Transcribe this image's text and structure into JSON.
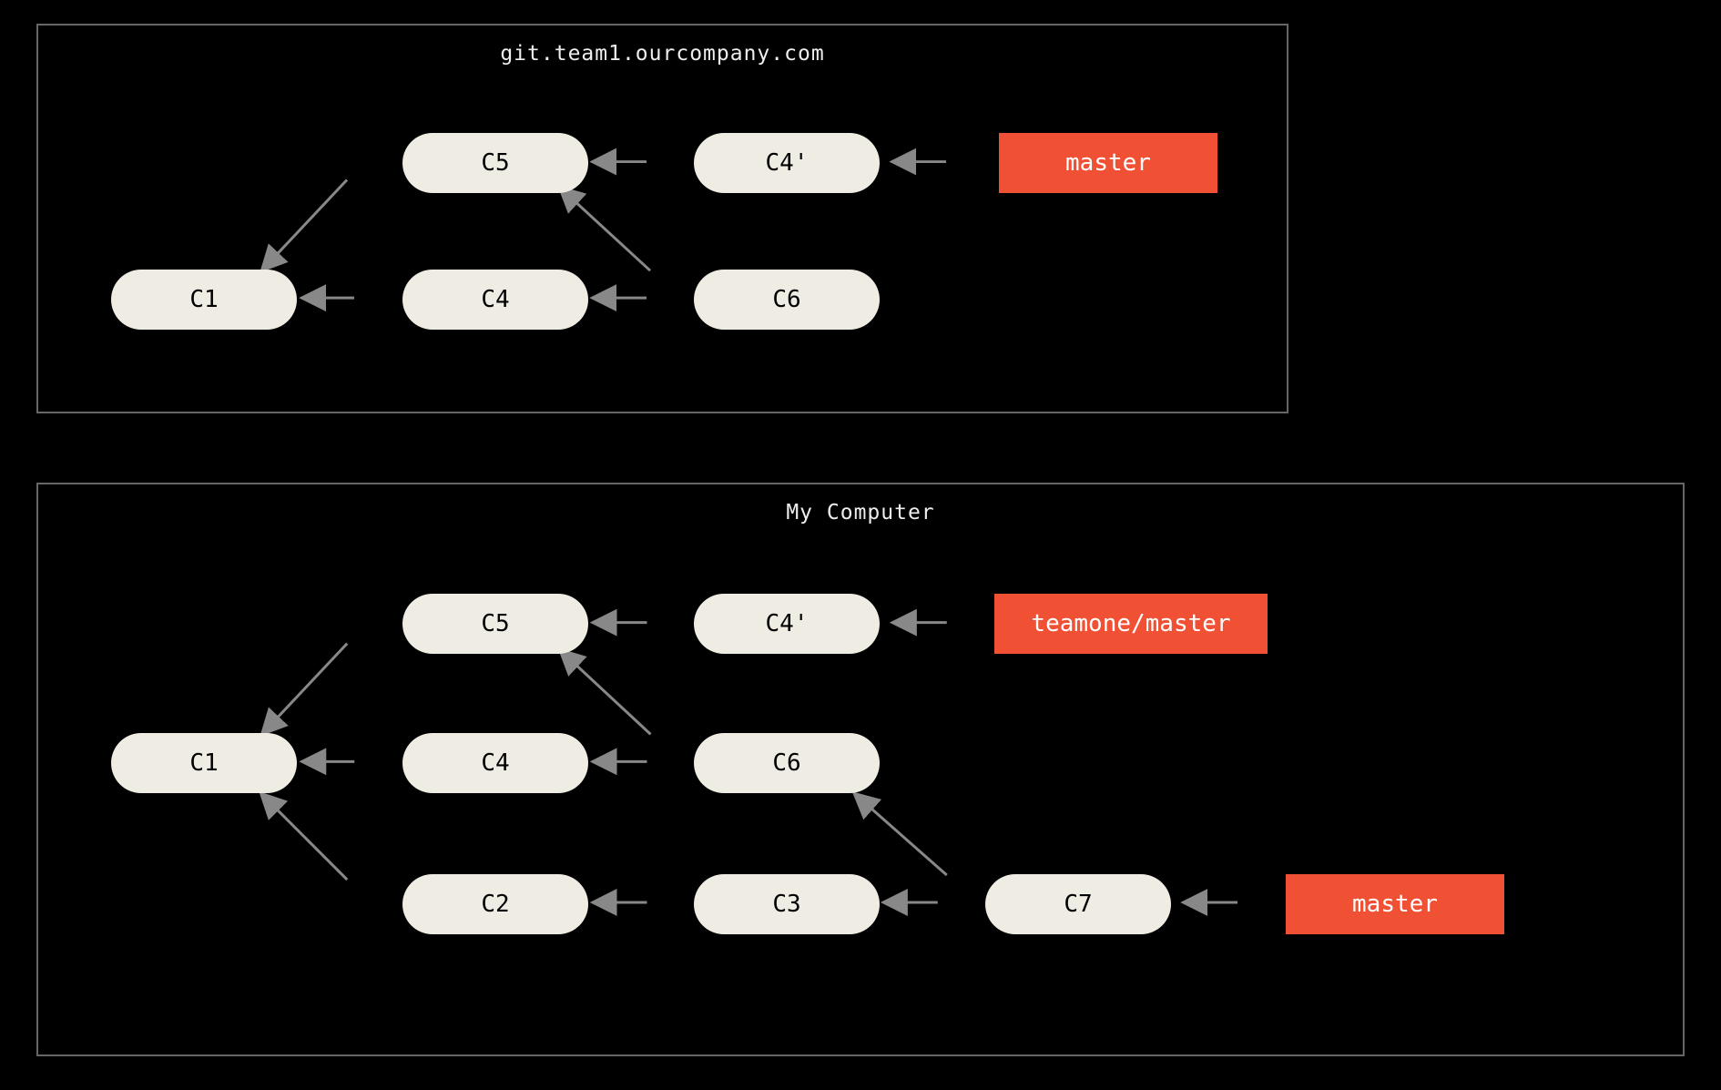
{
  "colors": {
    "background": "#000000",
    "panel_border": "#666666",
    "commit_fill": "#efece3",
    "ref_fill": "#f05033",
    "arrow": "#888888",
    "text_light": "#eeeeee"
  },
  "panels": {
    "remote": {
      "title": "git.team1.ourcompany.com",
      "commits": {
        "c1": "C1",
        "c4": "C4",
        "c5": "C5",
        "c6": "C6",
        "c4p": "C4'"
      },
      "refs": {
        "master": "master"
      },
      "edges": [
        {
          "from": "c5",
          "to": "c1"
        },
        {
          "from": "c4",
          "to": "c1"
        },
        {
          "from": "c6",
          "to": "c4"
        },
        {
          "from": "c6",
          "to": "c5"
        },
        {
          "from": "c4p",
          "to": "c5"
        },
        {
          "from_ref": "master",
          "to": "c4p"
        }
      ]
    },
    "local": {
      "title": "My Computer",
      "commits": {
        "c1": "C1",
        "c2": "C2",
        "c3": "C3",
        "c4": "C4",
        "c5": "C5",
        "c6": "C6",
        "c7": "C7",
        "c4p": "C4'"
      },
      "refs": {
        "teamone_master": "teamone/master",
        "master": "master"
      },
      "edges": [
        {
          "from": "c5",
          "to": "c1"
        },
        {
          "from": "c4",
          "to": "c1"
        },
        {
          "from": "c2",
          "to": "c1"
        },
        {
          "from": "c6",
          "to": "c4"
        },
        {
          "from": "c6",
          "to": "c5"
        },
        {
          "from": "c3",
          "to": "c2"
        },
        {
          "from": "c4p",
          "to": "c5"
        },
        {
          "from": "c7",
          "to": "c3"
        },
        {
          "from": "c7",
          "to": "c6"
        },
        {
          "from_ref": "teamone_master",
          "to": "c4p"
        },
        {
          "from_ref": "master",
          "to": "c7"
        }
      ]
    }
  }
}
